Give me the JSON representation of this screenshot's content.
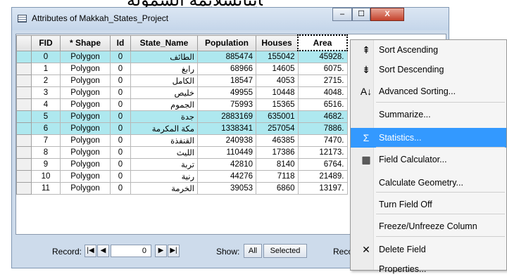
{
  "top_caption": "ﺎﻳﺘﺎﺋﺴﻼﻳﻤﻪ ﺍﻟﺸﻤﻮﻟﺔ",
  "window": {
    "title": "Attributes of Makkah_States_Project",
    "controls": {
      "minimize": "–",
      "maximize": "☐",
      "close": "X"
    }
  },
  "table": {
    "columns": [
      "FID",
      "* Shape",
      "Id",
      "State_Name",
      "Population",
      "Houses",
      "Area"
    ],
    "selected_column": "Area",
    "rows": [
      {
        "fid": "0",
        "shape": "Polygon",
        "id": "0",
        "name": "الطائف",
        "pop": "885474",
        "houses": "155042",
        "area": "45928.",
        "hl": true
      },
      {
        "fid": "1",
        "shape": "Polygon",
        "id": "0",
        "name": "رابغ",
        "pop": "68966",
        "houses": "14605",
        "area": "6075.",
        "hl": false
      },
      {
        "fid": "2",
        "shape": "Polygon",
        "id": "0",
        "name": "الكامل",
        "pop": "18547",
        "houses": "4053",
        "area": "2715.",
        "hl": false
      },
      {
        "fid": "3",
        "shape": "Polygon",
        "id": "0",
        "name": "خليص",
        "pop": "49955",
        "houses": "10448",
        "area": "4048.",
        "hl": false
      },
      {
        "fid": "4",
        "shape": "Polygon",
        "id": "0",
        "name": "الجموم",
        "pop": "75993",
        "houses": "15365",
        "area": "6516.",
        "hl": false
      },
      {
        "fid": "5",
        "shape": "Polygon",
        "id": "0",
        "name": "جدة",
        "pop": "2883169",
        "houses": "635001",
        "area": "4682.",
        "hl": true
      },
      {
        "fid": "6",
        "shape": "Polygon",
        "id": "0",
        "name": "مكة المكرمة",
        "pop": "1338341",
        "houses": "257054",
        "area": "7886.",
        "hl": true
      },
      {
        "fid": "7",
        "shape": "Polygon",
        "id": "0",
        "name": "القنفذة",
        "pop": "240938",
        "houses": "46385",
        "area": "7470.",
        "hl": false
      },
      {
        "fid": "8",
        "shape": "Polygon",
        "id": "0",
        "name": "الليث",
        "pop": "110449",
        "houses": "17386",
        "area": "12173.",
        "hl": false
      },
      {
        "fid": "9",
        "shape": "Polygon",
        "id": "0",
        "name": "تربة",
        "pop": "42810",
        "houses": "8140",
        "area": "6764.",
        "hl": false
      },
      {
        "fid": "10",
        "shape": "Polygon",
        "id": "0",
        "name": "رنية",
        "pop": "44276",
        "houses": "7118",
        "area": "21489.",
        "hl": false
      },
      {
        "fid": "11",
        "shape": "Polygon",
        "id": "0",
        "name": "الخرمة",
        "pop": "39053",
        "houses": "6860",
        "area": "13197.",
        "hl": false
      }
    ]
  },
  "footer": {
    "record_label": "Record:",
    "record_value": "0",
    "nav_first": "|◀",
    "nav_prev": "◀",
    "nav_next": "▶",
    "nav_last": "▶|",
    "show_label": "Show:",
    "show_all": "All",
    "show_selected": "Selected",
    "records_label": "Reco"
  },
  "context_menu": {
    "items": [
      {
        "label": "Sort Ascending",
        "icon": "sort-ascending-icon",
        "glyph": "⇞"
      },
      {
        "label": "Sort Descending",
        "icon": "sort-descending-icon",
        "glyph": "⇟"
      },
      {
        "label": "Advanced Sorting...",
        "icon": "advanced-sorting-icon",
        "glyph": "A↓"
      },
      {
        "label": "Summarize...",
        "icon": "",
        "glyph": ""
      },
      {
        "label": "Statistics...",
        "icon": "sigma-icon",
        "glyph": "Σ"
      },
      {
        "label": "Field Calculator...",
        "icon": "calculator-icon",
        "glyph": "▦"
      },
      {
        "label": "Calculate Geometry...",
        "icon": "",
        "glyph": ""
      },
      {
        "label": "Turn Field Off",
        "icon": "",
        "glyph": ""
      },
      {
        "label": "Freeze/Unfreeze Column",
        "icon": "",
        "glyph": ""
      },
      {
        "label": "Delete Field",
        "icon": "delete-x-icon",
        "glyph": "✕"
      },
      {
        "label": "Properties...",
        "icon": "",
        "glyph": ""
      }
    ],
    "highlighted": "Statistics..."
  },
  "colors": {
    "highlight_row": "#aee8ef",
    "menu_hover": "#3399ff",
    "window_frame": "#cddbeb"
  }
}
